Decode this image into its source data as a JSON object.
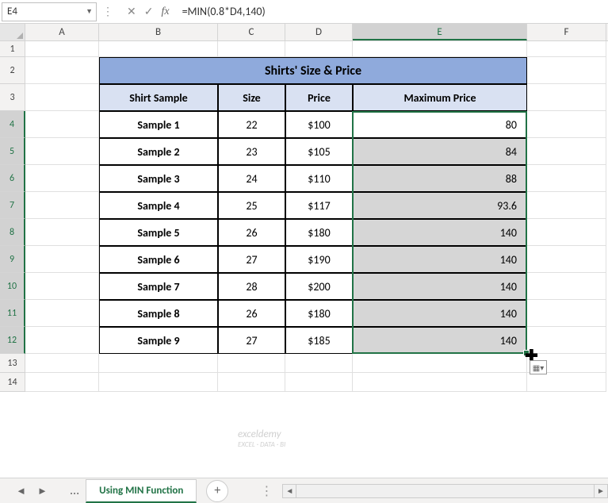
{
  "name_box": "E4",
  "formula": "=MIN(0.8*D4,140)",
  "fx_label": "fx",
  "columns": [
    "A",
    "B",
    "C",
    "D",
    "E",
    "F"
  ],
  "active_col": "E",
  "rows_labels": [
    "1",
    "2",
    "3",
    "4",
    "5",
    "6",
    "7",
    "8",
    "9",
    "10",
    "11",
    "12",
    "13",
    "14"
  ],
  "active_rows": [
    "4",
    "5",
    "6",
    "7",
    "8",
    "9",
    "10",
    "11",
    "12"
  ],
  "table": {
    "title": "Shirts' Size & Price",
    "headers": [
      "Shirt Sample",
      "Size",
      "Price",
      "Maximum Price"
    ],
    "rows": [
      {
        "sample": "Sample 1",
        "size": "22",
        "price": "$100",
        "max": "80"
      },
      {
        "sample": "Sample 2",
        "size": "23",
        "price": "$105",
        "max": "84"
      },
      {
        "sample": "Sample 3",
        "size": "24",
        "price": "$110",
        "max": "88"
      },
      {
        "sample": "Sample 4",
        "size": "25",
        "price": "$117",
        "max": "93.6"
      },
      {
        "sample": "Sample 5",
        "size": "26",
        "price": "$180",
        "max": "140"
      },
      {
        "sample": "Sample 6",
        "size": "27",
        "price": "$190",
        "max": "140"
      },
      {
        "sample": "Sample 7",
        "size": "28",
        "price": "$200",
        "max": "140"
      },
      {
        "sample": "Sample 8",
        "size": "26",
        "price": "$180",
        "max": "140"
      },
      {
        "sample": "Sample 9",
        "size": "27",
        "price": "$185",
        "max": "140"
      }
    ]
  },
  "sheet_tab": "Using MIN Function",
  "watermark": {
    "l1": "exceldemy",
    "l2": "EXCEL · DATA · BI"
  },
  "icons": {
    "cancel": "✕",
    "check": "✓",
    "dropdown": "▼",
    "left": "◄",
    "right": "►",
    "plus": "+",
    "dots": "⋮",
    "ellipsis": "..."
  }
}
